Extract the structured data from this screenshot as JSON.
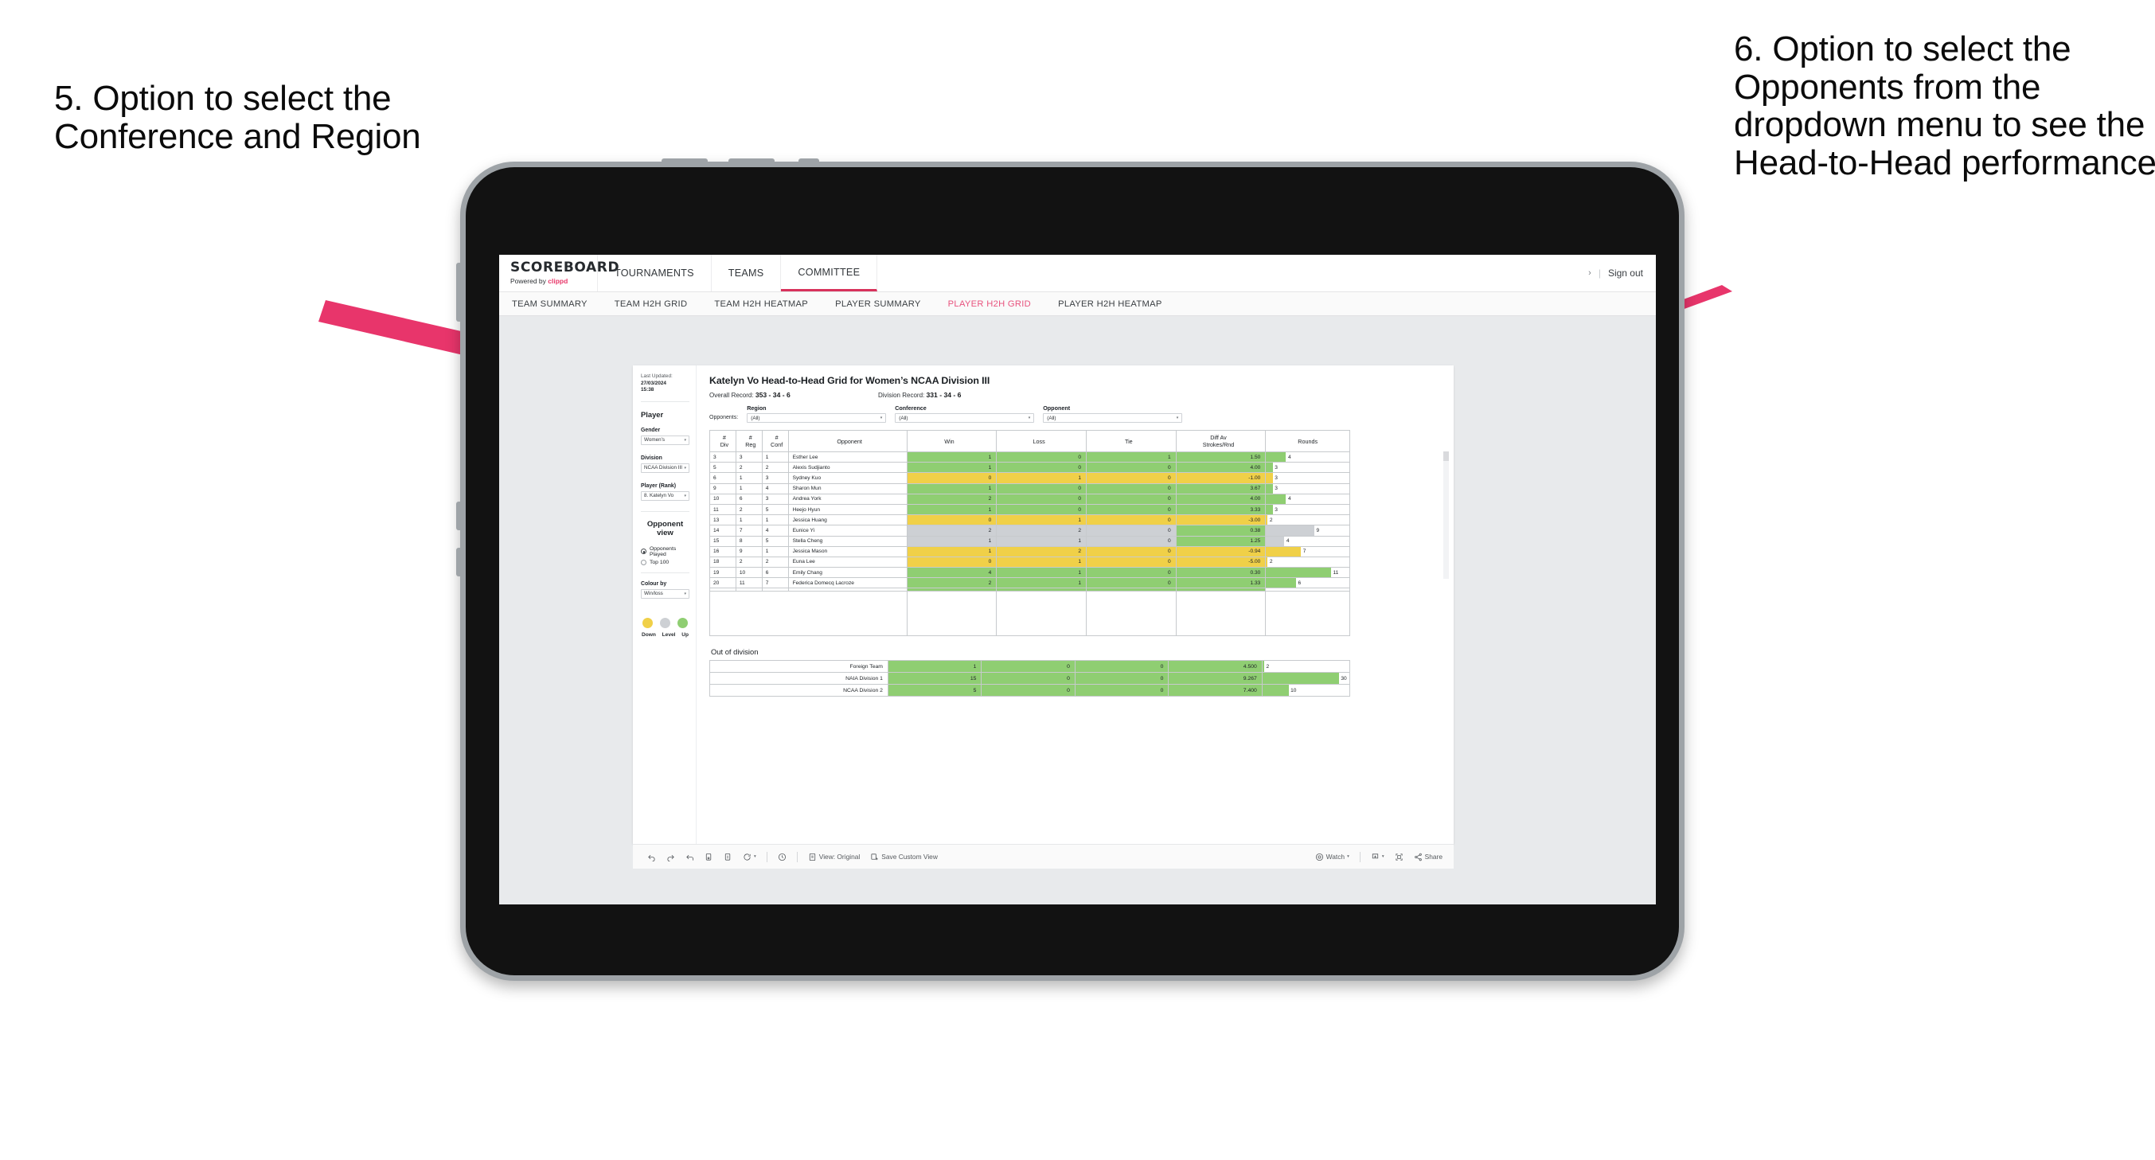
{
  "annotations": {
    "left": "5. Option to select the Conference and Region",
    "right": "6. Option to select the Opponents from the dropdown menu to see the Head-to-Head performance"
  },
  "appbar": {
    "brand_title": "SCOREBOARD",
    "brand_powered": "Powered by",
    "brand_name": "clippd",
    "tabs": [
      {
        "label": "TOURNAMENTS",
        "active": false
      },
      {
        "label": "TEAMS",
        "active": false
      },
      {
        "label": "COMMITTEE",
        "active": true
      }
    ],
    "chevron": "›",
    "divider": "|",
    "signout": "Sign out"
  },
  "subnav": {
    "items": [
      {
        "label": "TEAM SUMMARY",
        "active": false
      },
      {
        "label": "TEAM H2H GRID",
        "active": false
      },
      {
        "label": "TEAM H2H HEATMAP",
        "active": false
      },
      {
        "label": "PLAYER SUMMARY",
        "active": false
      },
      {
        "label": "PLAYER H2H GRID",
        "active": true
      },
      {
        "label": "PLAYER H2H HEATMAP",
        "active": false
      }
    ]
  },
  "sidebar": {
    "last_updated_label": "Last Updated:",
    "last_updated_date": "27/03/2024",
    "last_updated_time": "15:38",
    "player_heading": "Player",
    "gender_label": "Gender",
    "gender_value": "Women’s",
    "division_label": "Division",
    "division_value": "NCAA Division III",
    "player_rank_label": "Player (Rank)",
    "player_rank_value": "8. Katelyn Vo",
    "opponent_view_heading": "Opponent view",
    "opponent_view_options": [
      {
        "label": "Opponents Played",
        "selected": true
      },
      {
        "label": "Top 100",
        "selected": false
      }
    ],
    "colour_by_label": "Colour by",
    "colour_by_value": "Win/loss",
    "legend": [
      {
        "label": "Down",
        "color": "#f0d048"
      },
      {
        "label": "Level",
        "color": "#cdd0d4"
      },
      {
        "label": "Up",
        "color": "#8fce72"
      }
    ]
  },
  "main": {
    "title": "Katelyn Vo Head-to-Head Grid for Women’s NCAA Division III",
    "overall_record_label": "Overall Record:",
    "overall_record_value": "353 -  34 - 6",
    "division_record_label": "Division Record:",
    "division_record_value": "331 -  34 - 6",
    "opponents_label": "Opponents:",
    "filters": [
      {
        "label": "Region",
        "value": "(All)"
      },
      {
        "label": "Conference",
        "value": "(All)"
      },
      {
        "label": "Opponent",
        "value": "(All)"
      }
    ],
    "caret": "▾"
  },
  "chart_data": {
    "type": "table",
    "title": "Katelyn Vo Head-to-Head Grid for Women’s NCAA Division III",
    "columns": [
      "# Div",
      "# Reg",
      "# Conf",
      "Opponent",
      "Win",
      "Loss",
      "Tie",
      "Diff Av Strokes/Rnd",
      "Rounds"
    ],
    "column_headers_two_line": [
      {
        "l1": "#",
        "l2": "Div"
      },
      {
        "l1": "#",
        "l2": "Reg"
      },
      {
        "l1": "#",
        "l2": "Conf"
      },
      {
        "l1": "Opponent",
        "l2": ""
      },
      {
        "l1": "Win",
        "l2": ""
      },
      {
        "l1": "Loss",
        "l2": ""
      },
      {
        "l1": "Tie",
        "l2": ""
      },
      {
        "l1": "Diff Av",
        "l2": "Strokes/Rnd"
      },
      {
        "l1": "Rounds",
        "l2": ""
      }
    ],
    "rows": [
      {
        "div": "3",
        "reg": "3",
        "conf": "1",
        "opponent": "Esther Lee",
        "win": "1",
        "loss": "0",
        "tie": "1",
        "diff": "1.50",
        "rounds": "4",
        "color": "#8fce72",
        "bar_pct": 24
      },
      {
        "div": "5",
        "reg": "2",
        "conf": "2",
        "opponent": "Alexis Sudjianto",
        "win": "1",
        "loss": "0",
        "tie": "0",
        "diff": "4.00",
        "rounds": "3",
        "color": "#8fce72",
        "bar_pct": 8
      },
      {
        "div": "6",
        "reg": "1",
        "conf": "3",
        "opponent": "Sydney Kuo",
        "win": "0",
        "loss": "1",
        "tie": "0",
        "diff": "-1.00",
        "rounds": "3",
        "color": "#f0d048",
        "bar_pct": 8
      },
      {
        "div": "9",
        "reg": "1",
        "conf": "4",
        "opponent": "Sharon Mun",
        "win": "1",
        "loss": "0",
        "tie": "0",
        "diff": "3.67",
        "rounds": "3",
        "color": "#8fce72",
        "bar_pct": 8
      },
      {
        "div": "10",
        "reg": "6",
        "conf": "3",
        "opponent": "Andrea York",
        "win": "2",
        "loss": "0",
        "tie": "0",
        "diff": "4.00",
        "rounds": "4",
        "color": "#8fce72",
        "bar_pct": 24
      },
      {
        "div": "11",
        "reg": "2",
        "conf": "5",
        "opponent": "Heejo Hyun",
        "win": "1",
        "loss": "0",
        "tie": "0",
        "diff": "3.33",
        "rounds": "3",
        "color": "#8fce72",
        "bar_pct": 8
      },
      {
        "div": "13",
        "reg": "1",
        "conf": "1",
        "opponent": "Jessica Huang",
        "win": "0",
        "loss": "1",
        "tie": "0",
        "diff": "-3.00",
        "rounds": "2",
        "color": "#f0d048",
        "bar_pct": 2
      },
      {
        "div": "14",
        "reg": "7",
        "conf": "4",
        "opponent": "Eunice Yi",
        "win": "2",
        "loss": "2",
        "tie": "0",
        "diff": "0.38",
        "rounds": "9",
        "color": "#cdd0d4",
        "diff_color": "#8fce72",
        "bar_pct": 58
      },
      {
        "div": "15",
        "reg": "8",
        "conf": "5",
        "opponent": "Stella Cheng",
        "win": "1",
        "loss": "1",
        "tie": "0",
        "diff": "1.25",
        "rounds": "4",
        "color": "#cdd0d4",
        "diff_color": "#8fce72",
        "bar_pct": 22
      },
      {
        "div": "16",
        "reg": "9",
        "conf": "1",
        "opponent": "Jessica Mason",
        "win": "1",
        "loss": "2",
        "tie": "0",
        "diff": "-0.94",
        "rounds": "7",
        "color": "#f0d048",
        "bar_pct": 42
      },
      {
        "div": "18",
        "reg": "2",
        "conf": "2",
        "opponent": "Euna Lee",
        "win": "0",
        "loss": "1",
        "tie": "0",
        "diff": "-5.00",
        "rounds": "2",
        "color": "#f0d048",
        "bar_pct": 2
      },
      {
        "div": "19",
        "reg": "10",
        "conf": "6",
        "opponent": "Emily Chang",
        "win": "4",
        "loss": "1",
        "tie": "0",
        "diff": "0.30",
        "rounds": "11",
        "color": "#8fce72",
        "bar_pct": 78
      },
      {
        "div": "20",
        "reg": "11",
        "conf": "7",
        "opponent": "Federica Domecq Lacroze",
        "win": "2",
        "loss": "1",
        "tie": "0",
        "diff": "1.33",
        "rounds": "6",
        "color": "#8fce72",
        "bar_pct": 36
      }
    ],
    "out_of_division_title": "Out of division",
    "out_of_division_rows": [
      {
        "name": "Foreign Team",
        "win": "1",
        "loss": "0",
        "tie": "0",
        "diff": "4.500",
        "rounds": "2",
        "color": "#8fce72",
        "bar_pct": 2
      },
      {
        "name": "NAIA Division 1",
        "win": "15",
        "loss": "0",
        "tie": "0",
        "diff": "9.267",
        "rounds": "30",
        "color": "#8fce72",
        "bar_pct": 88
      },
      {
        "name": "NCAA Division 2",
        "win": "5",
        "loss": "0",
        "tie": "0",
        "diff": "7.400",
        "rounds": "10",
        "color": "#8fce72",
        "bar_pct": 30
      }
    ]
  },
  "toolbar": {
    "view_label": "View: Original",
    "save_label": "Save Custom View",
    "watch_label": "Watch",
    "share_label": "Share",
    "caret": "▾"
  }
}
